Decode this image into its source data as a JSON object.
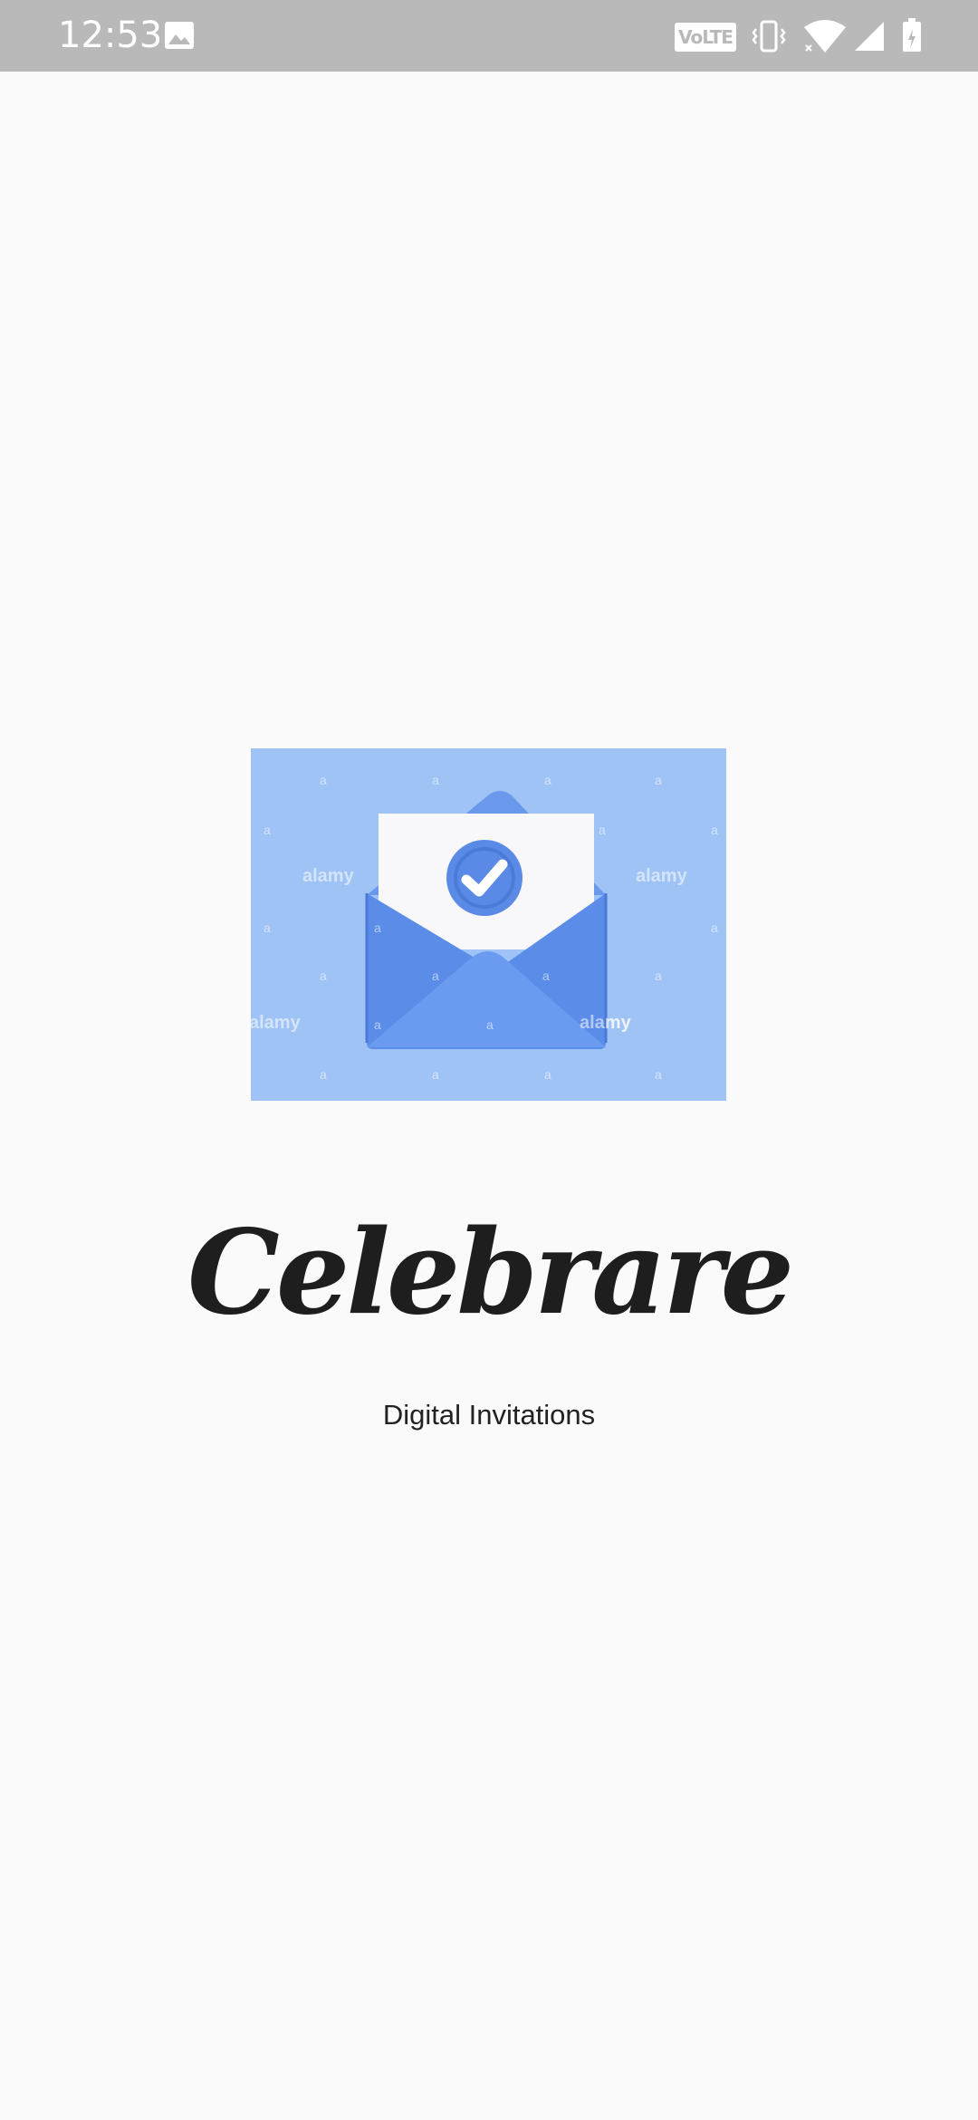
{
  "status_bar": {
    "time": "12:53",
    "volte_label": "VoLTE",
    "icons": [
      "gallery-icon",
      "volte-icon",
      "vibrate-icon",
      "wifi-icon",
      "signal-icon",
      "battery-icon"
    ],
    "background_color": "#b9b9b9"
  },
  "hero": {
    "image_name": "envelope-check-illustration",
    "watermark": "alamy",
    "watermark_small": "a",
    "background_color": "#9fc3f5",
    "envelope_color": "#5b8de8"
  },
  "app": {
    "title": "Celebrare",
    "subtitle": "Digital Invitations"
  }
}
